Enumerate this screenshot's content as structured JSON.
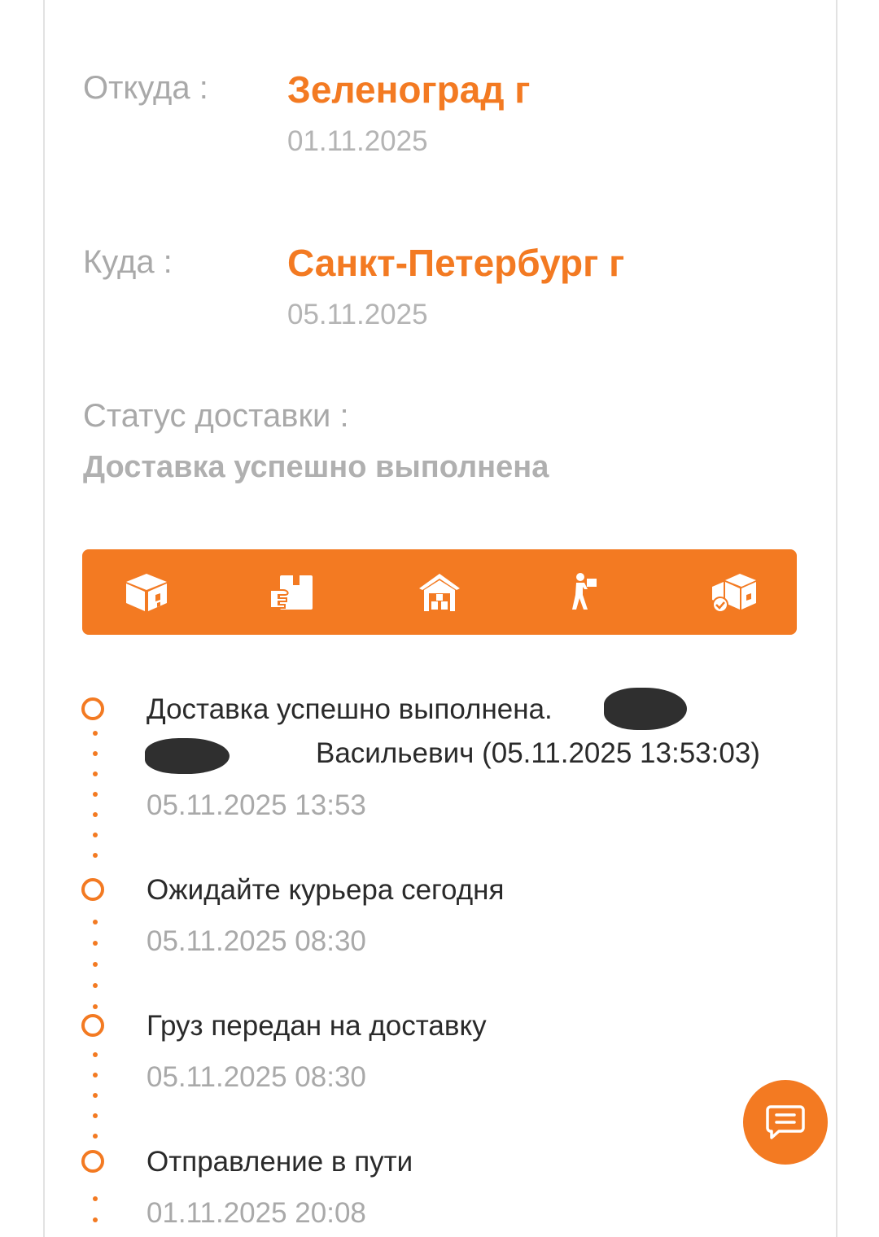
{
  "from": {
    "label": "Откуда :",
    "city": "Зеленоград г",
    "date": "01.11.2025"
  },
  "to": {
    "label": "Куда :",
    "city": "Санкт-Петербург г",
    "date": "05.11.2025"
  },
  "status": {
    "label": "Статус доставки :",
    "value": "Доставка успешно выполнена"
  },
  "steps": [
    {
      "icon": "box-icon"
    },
    {
      "icon": "hand-package-icon"
    },
    {
      "icon": "warehouse-icon"
    },
    {
      "icon": "courier-icon"
    },
    {
      "icon": "delivered-boxes-icon"
    }
  ],
  "timeline": [
    {
      "title_line1": "Доставка успешно выполнена.",
      "title_line2": "Васильевич (05.11.2025 13:53:03)",
      "date": "05.11.2025 13:53"
    },
    {
      "title": "Ожидайте курьера сегодня",
      "date": "05.11.2025 08:30"
    },
    {
      "title": "Груз передан на доставку",
      "date": "05.11.2025 08:30"
    },
    {
      "title": "Отправление в пути",
      "date": "01.11.2025 20:08"
    }
  ],
  "colors": {
    "accent": "#f37a22",
    "muted": "#a9a9a9",
    "text": "#2a2a2a"
  },
  "chat_button": {
    "icon": "chat-icon"
  }
}
